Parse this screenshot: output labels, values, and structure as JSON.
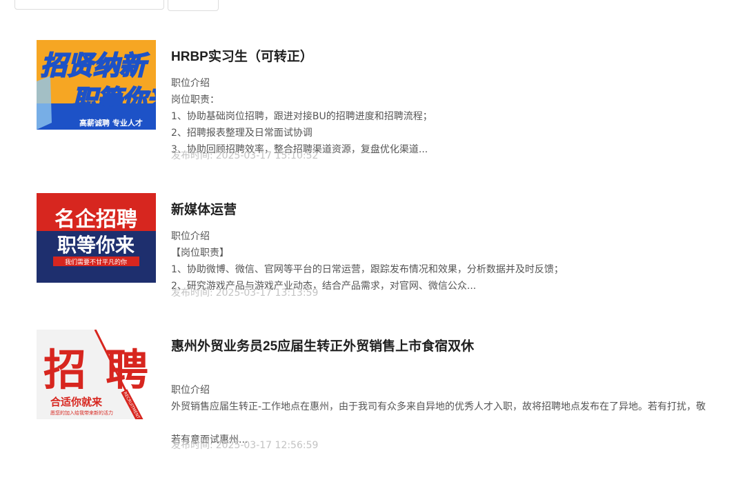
{
  "jobs": [
    {
      "title": "HRBP实习生（可转正）",
      "section_label": "职位介绍",
      "lines": [
        "岗位职责：",
        "1、协助基础岗位招聘，跟进对接BU的招聘进度和招聘流程；",
        "2、招聘报表整理及日常面试协调",
        "3、协助回顾招聘效率，整合招聘渠道资源，复盘优化渠道..."
      ],
      "publish_label": "发布时间:",
      "publish_time": "2025-03-17 15:10:52",
      "image_text": [
        "招贤纳新",
        "职等你来",
        "高薪诚聘 专业人才"
      ]
    },
    {
      "title": "新媒体运营",
      "section_label": "职位介绍",
      "lines": [
        "【岗位职责】",
        "1、协助微博、微信、官网等平台的日常运营，跟踪发布情况和效果，分析数据并及时反馈；",
        "2、研究游戏产品与游戏产业动态，结合产品需求，对官网、微信公众..."
      ],
      "publish_label": "发布时间:",
      "publish_time": "2025-03-17 13:13:59",
      "image_text": [
        "名企招聘",
        "职等你来",
        "我们需要不甘平凡的你"
      ]
    },
    {
      "title": "惠州外贸业务员25应届生转正外贸销售上市食宿双休",
      "section_label": "职位介绍",
      "lines": [
        "外贸销售应届生转正-工作地点在惠州，由于我司有众多来自异地的优秀人才入职，故将招聘地点发布在了异地。若有打扰，敬",
        "",
        "若有意面试惠州..."
      ],
      "publish_label": "发布时间:",
      "publish_time": "2025-03-17 12:56:59",
      "image_text": [
        "招",
        "聘",
        "合适你就来",
        "愿您的加入给我带来新的活力",
        "RECRUITMENT"
      ]
    }
  ],
  "colors": {
    "title": "#1f1f1f",
    "desc": "#555555",
    "meta": "#c3c3c3",
    "brand_red": "#d7261f",
    "brand_navy": "#1e2f6e",
    "banner_orange": "#f6a623",
    "banner_blue": "#1d52c7"
  }
}
